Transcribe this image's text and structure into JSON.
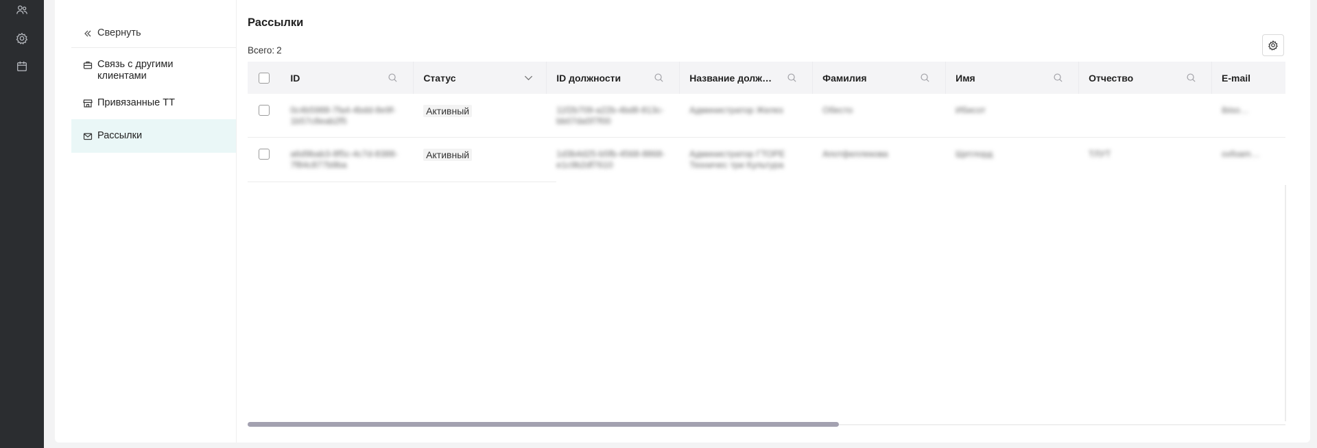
{
  "rail": {
    "icons": [
      "users-icon",
      "gear-icon",
      "calendar-icon"
    ]
  },
  "sidebar": {
    "collapse_label": "Свернуть",
    "items": [
      {
        "label": "Связь с другими клиентами",
        "icon": "briefcase-icon"
      },
      {
        "label": "Привязанные ТТ",
        "icon": "store-icon"
      },
      {
        "label": "Рассылки",
        "icon": "mail-icon",
        "active": true
      }
    ]
  },
  "main": {
    "title": "Рассылки",
    "total_label": "Всего:",
    "total_value": "2"
  },
  "table": {
    "columns": [
      {
        "label": "ID",
        "action": "search-icon"
      },
      {
        "label": "Статус",
        "action": "chevron-down-icon"
      },
      {
        "label": "ID должности",
        "action": "search-icon"
      },
      {
        "label": "Название должн…",
        "action": "search-icon"
      },
      {
        "label": "Фамилия",
        "action": "search-icon"
      },
      {
        "label": "Имя",
        "action": "search-icon"
      },
      {
        "label": "Отчество",
        "action": "search-icon"
      },
      {
        "label": "E-mail",
        "action": ""
      }
    ],
    "rows": [
      {
        "id": "0c4b5988-7fa4-4bdd-8e9f-1b57c8eab2f5",
        "status": "Активный",
        "position_id": "11f2b709-a22b-4bd8-813c-bb07da5f7f00",
        "position_name": "Администратор Желез",
        "last_name": "Обесто",
        "first_name": "Ибисот",
        "middle_name": "",
        "email": "ibiso…"
      },
      {
        "id": "a6d9bab3-8f5c-4c7d-8388-7f84c877b9ba",
        "status": "Активный",
        "position_id": "1d3b4d25-b5fb-4568-8868-e1c9b2df7610",
        "position_name": "Администратор ГТОРЕ Техничес три Культура",
        "last_name": "Апотфеллекова",
        "first_name": "Щетлорд",
        "middle_name": "ТЛУТ",
        "email": "oxfoam…"
      }
    ]
  }
}
